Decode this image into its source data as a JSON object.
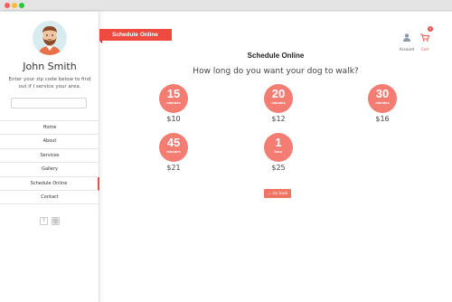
{
  "window": {
    "controls": [
      "close",
      "minimize",
      "maximize"
    ]
  },
  "sidebar": {
    "user_name": "John Smith",
    "zip_prompt": "Enter your zip code below to find out if I service your area.",
    "zip_input_value": "",
    "nav_items": [
      {
        "label": "Home"
      },
      {
        "label": "About"
      },
      {
        "label": "Services"
      },
      {
        "label": "Gallery"
      },
      {
        "label": "Schedule Online",
        "active": true
      },
      {
        "label": "Contact"
      }
    ],
    "social_icons": [
      "facebook-icon",
      "instagram-icon"
    ]
  },
  "header": {
    "ribbon_label": "Schedule Online",
    "account_label": "Account",
    "cart_label": "Cart",
    "cart_count": "0"
  },
  "main": {
    "heading": "Schedule Online",
    "question": "How long do you want your dog to walk?",
    "options": [
      {
        "amount": "15",
        "unit": "minutes",
        "price": "$10"
      },
      {
        "amount": "20",
        "unit": "minutes",
        "price": "$12"
      },
      {
        "amount": "30",
        "unit": "minutes",
        "price": "$16"
      },
      {
        "amount": "45",
        "unit": "minutes",
        "price": "$21"
      },
      {
        "amount": "1",
        "unit": "hour",
        "price": "$25"
      }
    ],
    "go_back_label": "← Go back"
  },
  "colors": {
    "accent": "#ee4a3f",
    "circle": "#f37d72",
    "button": "#f07565"
  }
}
